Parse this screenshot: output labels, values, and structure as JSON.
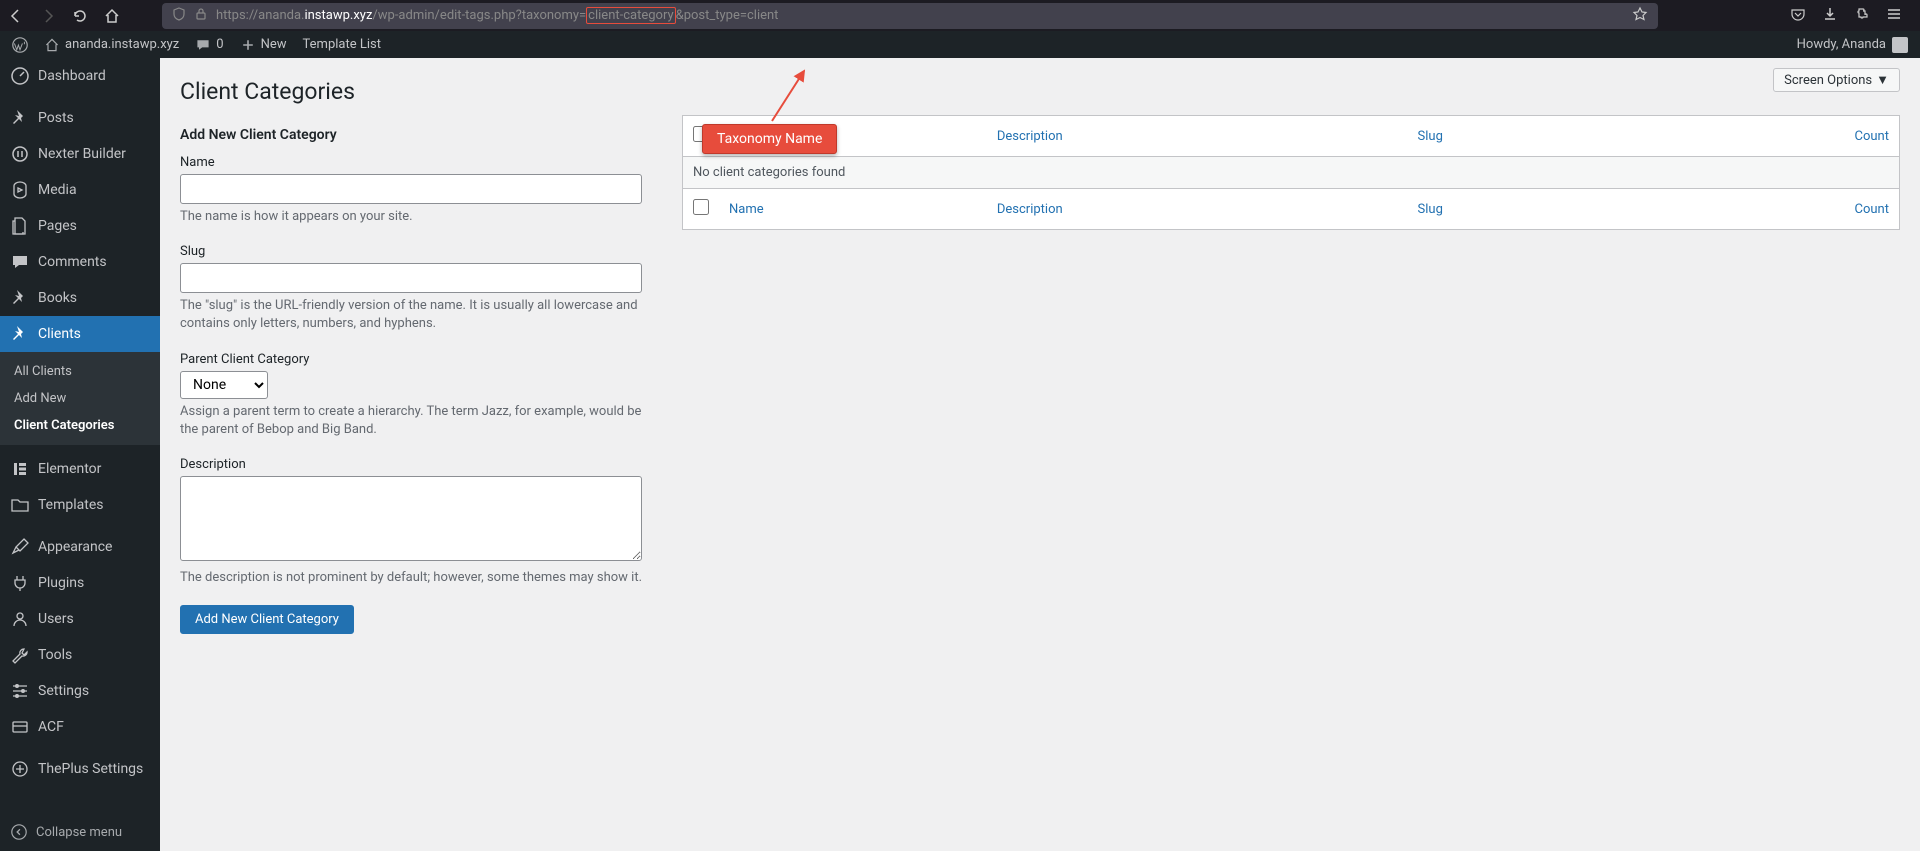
{
  "browser": {
    "url_prefix": "https://ananda.",
    "url_domain": "instawp.xyz",
    "url_path1": "/wp-admin/edit-tags.php?taxonomy=",
    "url_highlight": "client-category",
    "url_path2": "&post_type=client"
  },
  "adminbar": {
    "site_name": "ananda.instawp.xyz",
    "comments": "0",
    "new": "New",
    "template_list": "Template List",
    "howdy": "Howdy, Ananda"
  },
  "sidebar": {
    "items": [
      {
        "label": "Dashboard",
        "icon": "dashboard"
      },
      {
        "label": "Posts",
        "icon": "pin"
      },
      {
        "label": "Nexter Builder",
        "icon": "nexter"
      },
      {
        "label": "Media",
        "icon": "media"
      },
      {
        "label": "Pages",
        "icon": "page"
      },
      {
        "label": "Comments",
        "icon": "comment"
      },
      {
        "label": "Books",
        "icon": "pin"
      },
      {
        "label": "Clients",
        "icon": "pin"
      },
      {
        "label": "Elementor",
        "icon": "elementor"
      },
      {
        "label": "Templates",
        "icon": "folder"
      },
      {
        "label": "Appearance",
        "icon": "brush"
      },
      {
        "label": "Plugins",
        "icon": "plug"
      },
      {
        "label": "Users",
        "icon": "user"
      },
      {
        "label": "Tools",
        "icon": "wrench"
      },
      {
        "label": "Settings",
        "icon": "sliders"
      },
      {
        "label": "ACF",
        "icon": "acf"
      },
      {
        "label": "ThePlus Settings",
        "icon": "plus"
      }
    ],
    "submenu": [
      {
        "label": "All Clients"
      },
      {
        "label": "Add New"
      },
      {
        "label": "Client Categories"
      }
    ],
    "collapse": "Collapse menu"
  },
  "page": {
    "screen_options": "Screen Options",
    "title": "Client Categories",
    "form_title": "Add New Client Category",
    "name_label": "Name",
    "name_desc": "The name is how it appears on your site.",
    "slug_label": "Slug",
    "slug_desc": "The \"slug\" is the URL-friendly version of the name. It is usually all lowercase and contains only letters, numbers, and hyphens.",
    "parent_label": "Parent Client Category",
    "parent_option": "None",
    "parent_desc": "Assign a parent term to create a hierarchy. The term Jazz, for example, would be the parent of Bebop and Big Band.",
    "desc_label": "Description",
    "desc_desc": "The description is not prominent by default; however, some themes may show it.",
    "submit": "Add New Client Category"
  },
  "table": {
    "col_name": "Name",
    "col_description": "Description",
    "col_slug": "Slug",
    "col_count": "Count",
    "empty": "No client categories found"
  },
  "annotation": {
    "label": "Taxonomy Name"
  }
}
